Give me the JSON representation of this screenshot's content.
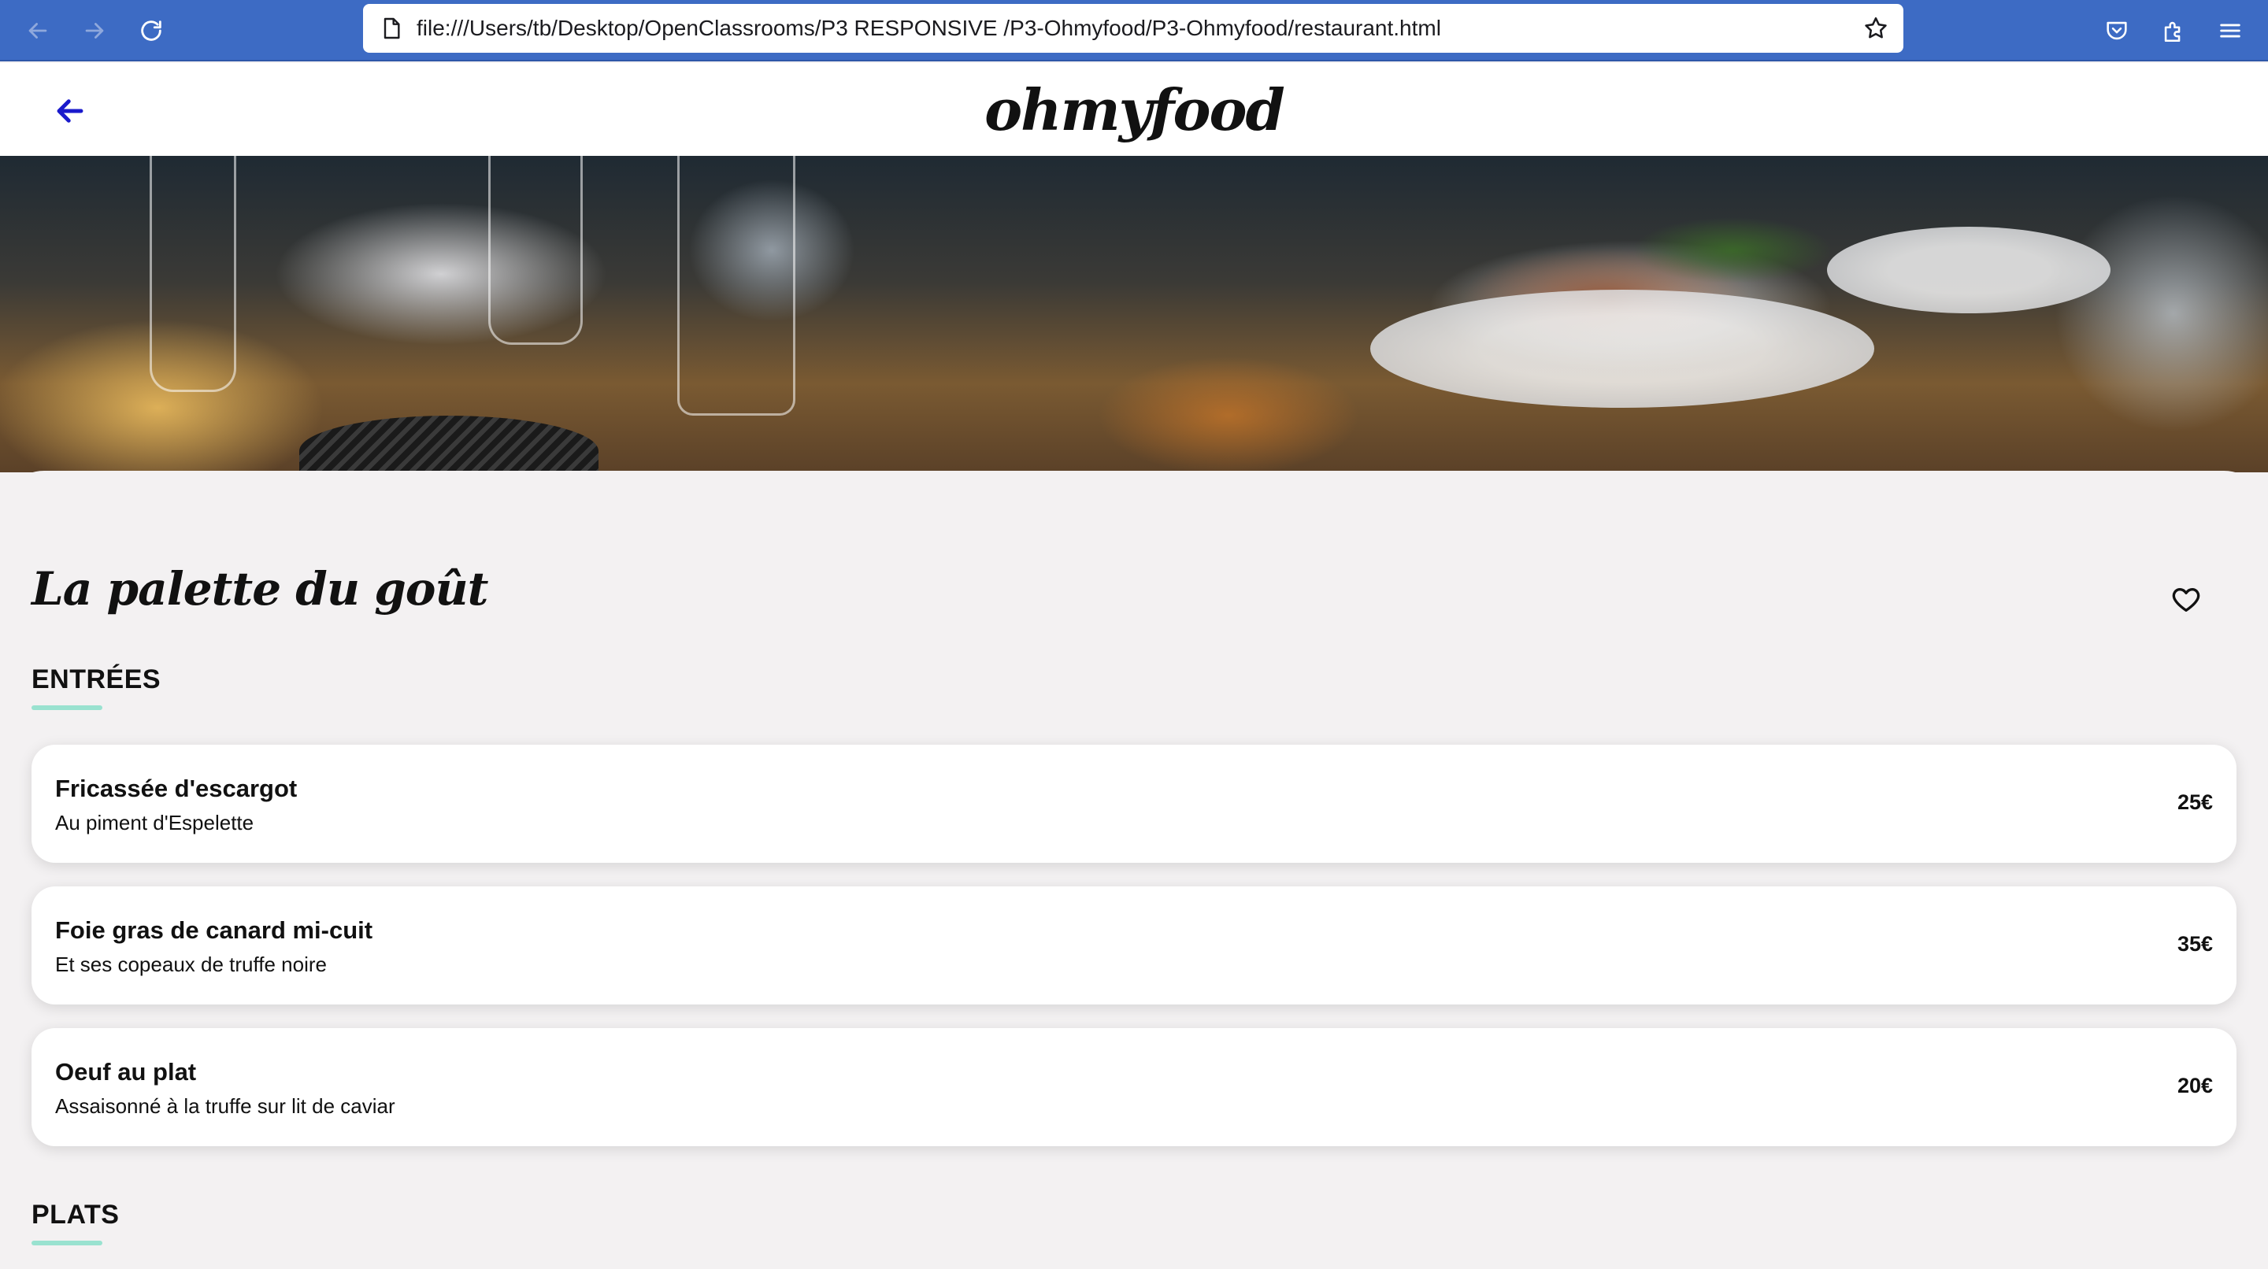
{
  "browser": {
    "url": "file:///Users/tb/Desktop/OpenClassrooms/P3 RESPONSIVE /P3-Ohmyfood/P3-Ohmyfood/restaurant.html",
    "icons": [
      "back-icon",
      "forward-icon",
      "reload-icon",
      "page-icon",
      "bookmark-star-icon",
      "pocket-icon",
      "extensions-icon",
      "menu-icon"
    ],
    "chrome_color": "#3d6bc4"
  },
  "header": {
    "logo": "ohmyfood",
    "back_icon": "arrow-left-icon",
    "accent": "#1a1acc"
  },
  "restaurant": {
    "name": "La palette du goût",
    "favorite_icon": "heart-outline-icon"
  },
  "menu": {
    "accent": "#99e2d0",
    "sections": [
      {
        "title": "ENTRÉES",
        "dishes": [
          {
            "name": "Fricassée d'escargot",
            "description": "Au piment d'Espelette",
            "price": "25€"
          },
          {
            "name": "Foie gras de canard mi-cuit",
            "description": "Et ses copeaux de truffe noire",
            "price": "35€"
          },
          {
            "name": "Oeuf au plat",
            "description": "Assaisonné à la truffe sur lit de caviar",
            "price": "20€"
          }
        ]
      },
      {
        "title": "PLATS",
        "dishes": []
      }
    ]
  }
}
